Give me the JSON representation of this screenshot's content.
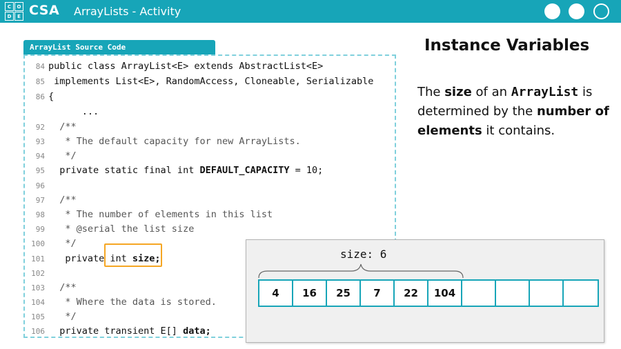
{
  "header": {
    "logo_letters": [
      "C",
      "O",
      "D",
      "E"
    ],
    "brand": "CSA",
    "title": "ArrayLists - Activity",
    "bg_color": "#17a5b8"
  },
  "code_panel": {
    "tab_label": "ArrayList Source Code",
    "lines": [
      {
        "num": "84",
        "text": "public class ArrayList<E> extends AbstractList<E>"
      },
      {
        "num": "85",
        "text": " implements List<E>, RandomAccess, Cloneable, Serializable"
      },
      {
        "num": "86",
        "text": "{"
      },
      {
        "num": "",
        "text": "      ..."
      },
      {
        "num": "92",
        "text": "  /**"
      },
      {
        "num": "93",
        "text": "   * The default capacity for new ArrayLists."
      },
      {
        "num": "94",
        "text": "   */"
      },
      {
        "num": "95",
        "text": "  private static final int DEFAULT_CAPACITY = 10;"
      },
      {
        "num": "96",
        "text": ""
      },
      {
        "num": "97",
        "text": "  /**"
      },
      {
        "num": "98",
        "text": "   * The number of elements in this list"
      },
      {
        "num": "99",
        "text": "   * @serial the list size"
      },
      {
        "num": "100",
        "text": "   */"
      },
      {
        "num": "101",
        "text": "   private int size;"
      },
      {
        "num": "102",
        "text": ""
      },
      {
        "num": "103",
        "text": "  /**"
      },
      {
        "num": "104",
        "text": "   * Where the data is stored."
      },
      {
        "num": "105",
        "text": "   */"
      },
      {
        "num": "106",
        "text": "  private transient E[] data;"
      }
    ]
  },
  "slide": {
    "heading": "Instance Variables",
    "desc_parts": {
      "p1": "The ",
      "b1": "size",
      "p2": " of an ",
      "code": "ArrayList",
      "p3": " is determined by the ",
      "b2": "number of elements",
      "p4": " it contains."
    }
  },
  "array": {
    "size_label": "size: 6",
    "cells": [
      "4",
      "16",
      "25",
      "7",
      "22",
      "104",
      "",
      "",
      "",
      ""
    ],
    "border_color": "#17a5b8"
  }
}
